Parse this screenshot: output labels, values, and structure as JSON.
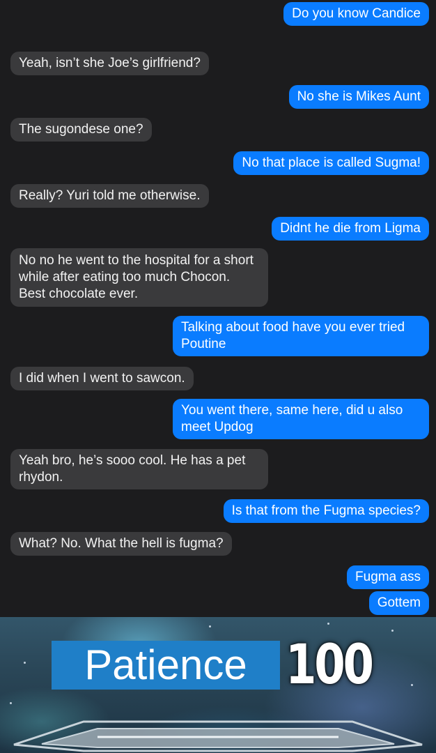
{
  "conversation": {
    "messages": [
      {
        "side": "out",
        "text": "Do you know Candice"
      },
      {
        "side": "in",
        "text": "Yeah, isn’t she Joe’s girlfriend?"
      },
      {
        "side": "out",
        "text": "No she is Mikes Aunt"
      },
      {
        "side": "in",
        "text": "The sugondese one?"
      },
      {
        "side": "out",
        "text": "No that place is called Sugma!"
      },
      {
        "side": "in",
        "text": "Really? Yuri told me otherwise."
      },
      {
        "side": "out",
        "text": "Didnt he die from Ligma"
      },
      {
        "side": "in",
        "text": "No no he went to the hospital for a short while after eating too much Chocon. Best chocolate ever."
      },
      {
        "side": "out",
        "text": "Talking about food have you ever tried Poutine"
      },
      {
        "side": "in",
        "text": "I did when I went to sawcon."
      },
      {
        "side": "out",
        "text": "You went there, same here, did u also meet Updog"
      },
      {
        "side": "in",
        "text": "Yeah bro, he’s sooo cool. He has a pet rhydon."
      },
      {
        "side": "out",
        "text": "Is that from the Fugma species?"
      },
      {
        "side": "in",
        "text": "What? No. What the hell is fugma?"
      },
      {
        "side": "out",
        "text": "Fugma ass"
      },
      {
        "side": "out",
        "text": "Gottem"
      }
    ]
  },
  "meme_banner": {
    "skill_name": "Patience",
    "skill_level": "100"
  },
  "colors": {
    "background": "#1c1c1e",
    "incoming_bubble": "#3a3a3c",
    "outgoing_bubble": "#0a7cff",
    "skill_label_bg": "#1f7fc8"
  }
}
